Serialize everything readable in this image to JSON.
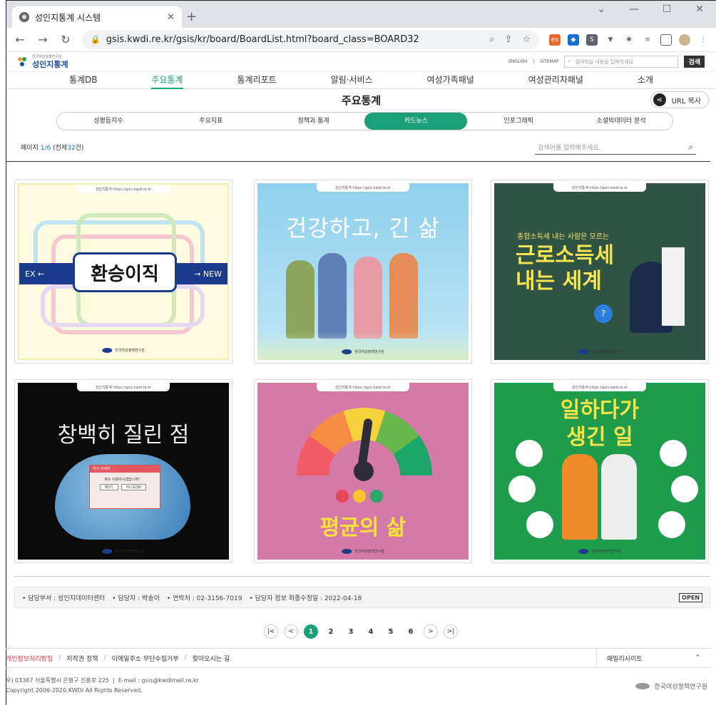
{
  "browser": {
    "tab_title": "성인지통계 시스템",
    "url": "gsis.kwdi.re.kr/gsis/kr/board/BoardList.html?board_class=BOARD32"
  },
  "site": {
    "logo_small": "한국여성정책연구원",
    "logo_name": "성인지통계",
    "english": "ENGLISH",
    "sitemap": "SITEMAP",
    "search_placeholder": "검색하실 내용을 입력하세요",
    "search_button": "검색"
  },
  "gnb": [
    "통계DB",
    "주요통계",
    "통계리포트",
    "알림·서비스",
    "여성가족패널",
    "여성관리자패널",
    "소개"
  ],
  "page": {
    "title": "주요통계",
    "url_copy": "URL 복사"
  },
  "subtabs": [
    "성평등지수",
    "주요지표",
    "정책과 통계",
    "카드뉴스",
    "인포그래픽",
    "소셜빅데이터 분석"
  ],
  "listinfo": {
    "prefix": "페이지",
    "page": "1/6",
    "total_prefix": "(전체",
    "total": "32",
    "total_suffix": "건)",
    "search_placeholder": "검색어를 입력해주세요."
  },
  "cards": {
    "banner": "성인지통계 https://gsis.kwdi.re.kr",
    "org": "한국여성정책연구원",
    "c1": {
      "left": "EX ←",
      "center": "환승이직",
      "right": "→ NEW"
    },
    "c2": {
      "headline": "건강하고, 긴 삶"
    },
    "c3": {
      "small": "종합소득세 내는 사람은 모르는",
      "line1": "근로소득세",
      "line2": "내는 세계"
    },
    "c4": {
      "headline": "창백히 질린 점",
      "dialog_title": "지구 이세지",
      "dialog_text": "계속 이용하시겠습니까?",
      "ok": "예(Y)",
      "no": "아니요(N)"
    },
    "c5": {
      "headline": "평균의 삶"
    },
    "c6": {
      "line1": "일하다가",
      "line2": "생긴 일"
    }
  },
  "info": {
    "dept": "• 담당부서 : 성인지데이터센터",
    "manager": "• 담당자 : 박송이",
    "contact": "• 연락처 : 02-3156-7019",
    "updated": "• 담당자 정보 최종수정일 : 2022-04-18",
    "open": "OPEN"
  },
  "pager": {
    "first": "|<",
    "prev": "<",
    "pages": [
      "1",
      "2",
      "3",
      "4",
      "5",
      "6"
    ],
    "next": ">",
    "last": ">|"
  },
  "footer": {
    "privacy": "개인정보처리방침",
    "copyright_policy": "저작권 정책",
    "email_refuse": "이메일주소 무단수집거부",
    "directions": "찾아오시는 길",
    "family": "패밀리사이트",
    "address": "우) 03367 서울특별시 은평구 진흥로 225",
    "email": "E-mail : gsis@kwdimail.re.kr",
    "copyright": "Copyright 2006-2020.KWDI All Rights Reserved.",
    "org": "한국여성정책연구원"
  }
}
